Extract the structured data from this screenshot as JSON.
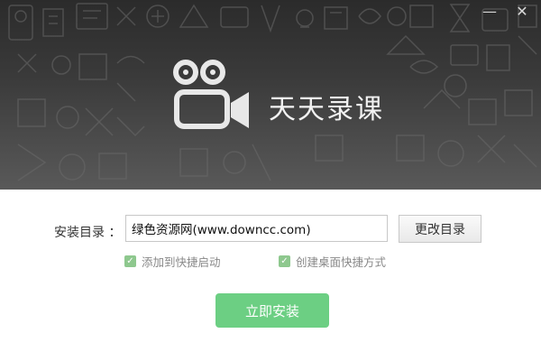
{
  "window": {
    "minimize_symbol": "—",
    "close_symbol": "✕"
  },
  "header": {
    "app_title": "天天录课",
    "logo_icon": "video-camera-icon"
  },
  "install": {
    "dir_label": "安装目录 ：",
    "dir_value": "绿色资源网(www.downcc.com)",
    "change_button": "更改目录",
    "options": [
      {
        "label": "添加到快捷启动",
        "checked": true
      },
      {
        "label": "创建桌面快捷方式",
        "checked": true
      }
    ],
    "install_button": "立即安装"
  },
  "colors": {
    "header_top": "#2b2b2b",
    "header_bottom": "#595959",
    "install_button": "#6ccf83",
    "checkbox": "#8ec88e"
  }
}
